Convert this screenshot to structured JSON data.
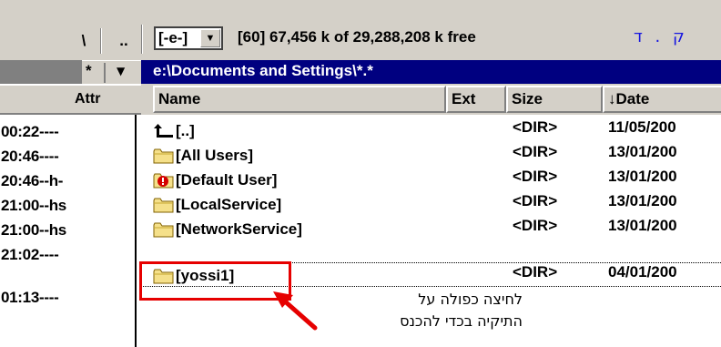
{
  "left_panel": {
    "toolbar": {
      "root_label": "\\",
      "up_label": "..",
      "filter_label": "*",
      "sort_label": "▼"
    },
    "header": {
      "attr_label": "Attr"
    },
    "rows": [
      "00:22----",
      "20:46----",
      "20:46--h-",
      "21:00--hs",
      "21:00--hs",
      "21:02----",
      "01:13----"
    ]
  },
  "toolbar": {
    "drive": "[-e-]",
    "dropdown_arrow": "▼",
    "free_space": "[60]  67,456 k of 29,288,208 k free",
    "hebrew_chars": "ק . ד"
  },
  "path": "e:\\Documents and Settings\\*.*",
  "columns": {
    "name": "Name",
    "ext": "Ext",
    "size": "Size",
    "date": "↓Date"
  },
  "files": [
    {
      "name": "[..]",
      "icon": "up-arrow-icon",
      "size": "<DIR>",
      "date": "11/05/200"
    },
    {
      "name": "[All Users]",
      "icon": "folder-icon",
      "size": "<DIR>",
      "date": "13/01/200"
    },
    {
      "name": "[Default User]",
      "icon": "folder-warning-icon",
      "size": "<DIR>",
      "date": "13/01/200"
    },
    {
      "name": "[LocalService]",
      "icon": "folder-icon",
      "size": "<DIR>",
      "date": "13/01/200"
    },
    {
      "name": "[NetworkService]",
      "icon": "folder-icon",
      "size": "<DIR>",
      "date": "13/01/200"
    },
    {
      "name": "[yossi1]",
      "icon": "folder-icon",
      "size": "<DIR>",
      "date": "04/01/200"
    }
  ],
  "annotation": {
    "line1": "לחיצה כפולה על",
    "line2": "התיקיה בכדי להכנס"
  },
  "colors": {
    "path_bar": "#000080",
    "panel_gray": "#d4d0c8",
    "highlight_red": "#e60000",
    "hebrew_blue": "#1515e0"
  }
}
